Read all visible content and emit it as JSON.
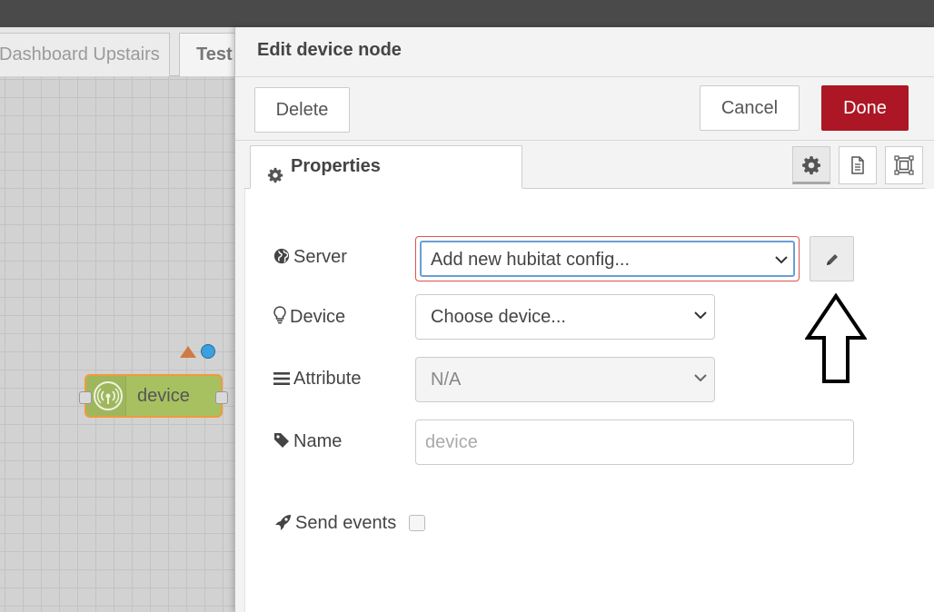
{
  "workspace": {
    "tabs": [
      {
        "label": "Dashboard Upstairs"
      },
      {
        "label": "Test"
      }
    ],
    "node": {
      "label": "device"
    }
  },
  "tray": {
    "title": "Edit device node",
    "toolbar": {
      "delete_label": "Delete",
      "cancel_label": "Cancel",
      "done_label": "Done"
    },
    "tabs": {
      "properties_label": "Properties"
    },
    "form": {
      "server": {
        "label": "Server",
        "selected": "Add new hubitat config..."
      },
      "device": {
        "label": "Device",
        "selected": "Choose device..."
      },
      "attribute": {
        "label": "Attribute",
        "selected": "N/A"
      },
      "name": {
        "label": "Name",
        "value": "",
        "placeholder": "device"
      },
      "send_events": {
        "label": "Send events",
        "checked": false
      }
    }
  },
  "colors": {
    "done_button": "#ad1625",
    "node_fill": "#a7c161",
    "node_border": "#f09a3a",
    "changed_indicator": "#3c9fde"
  },
  "icons": [
    "gear-icon",
    "globe-icon",
    "lightbulb-icon",
    "list-icon",
    "tag-icon",
    "rocket-icon",
    "pencil-icon",
    "document-icon",
    "frame-icon",
    "chevron-down-icon",
    "arrow-up-annotation"
  ]
}
